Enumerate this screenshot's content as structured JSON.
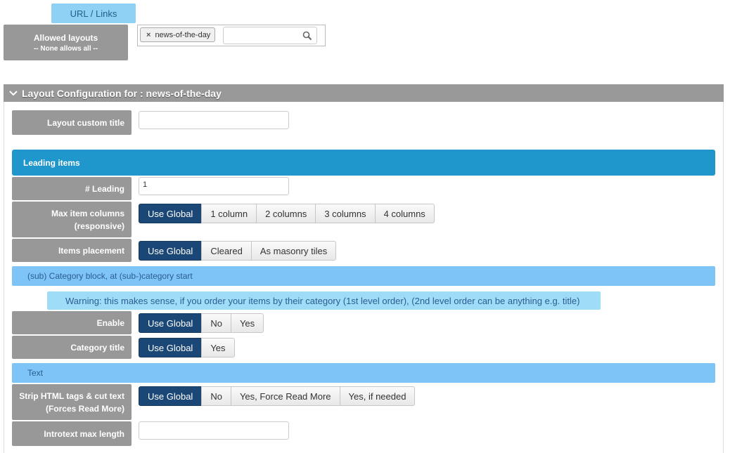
{
  "url_links_tab": "URL / Links",
  "allowed_layouts": {
    "label": "Allowed layouts",
    "sublabel": "-- None allows all --",
    "tags": [
      "news-of-the-day"
    ],
    "search_value": ""
  },
  "layout_config": {
    "header": "Layout Configuration for : news-of-the-day",
    "custom_title": {
      "label": "Layout custom title",
      "value": ""
    },
    "leading_section": "Leading items",
    "leading": {
      "label": "# Leading",
      "value": "1"
    },
    "max_columns": {
      "label_line1": "Max item columns",
      "label_line2": "(responsive)",
      "options": [
        "Use Global",
        "1 column",
        "2 columns",
        "3 columns",
        "4 columns"
      ],
      "selected": "Use Global"
    },
    "placement": {
      "label": "Items placement",
      "options": [
        "Use Global",
        "Cleared",
        "As masonry tiles"
      ],
      "selected": "Use Global"
    },
    "subcategory_section": "(sub) Category block, at (sub-)category start",
    "warning": "Warning: this makes sense, if you order your items by their category (1st level order), (2nd level order can be anything e.g. title)",
    "enable": {
      "label": "Enable",
      "options": [
        "Use Global",
        "No",
        "Yes"
      ],
      "selected": "Use Global"
    },
    "category_title": {
      "label": "Category title",
      "options": [
        "Use Global",
        "Yes"
      ],
      "selected": "Use Global"
    },
    "text_section": "Text",
    "strip_html": {
      "label_line1": "Strip HTML tags & cut text",
      "label_line2": "(Forces Read More)",
      "options": [
        "Use Global",
        "No",
        "Yes, Force Read More",
        "Yes, if needed"
      ],
      "selected": "Use Global"
    },
    "introtext_max": {
      "label": "Introtext max length",
      "value": ""
    }
  },
  "colors": {
    "label_bg": "#989898",
    "section_bar": "#1f96cc",
    "sub_bar": "#7fc4f7",
    "warning_bg": "#9fdcf8",
    "active_button": "#1a4775"
  }
}
